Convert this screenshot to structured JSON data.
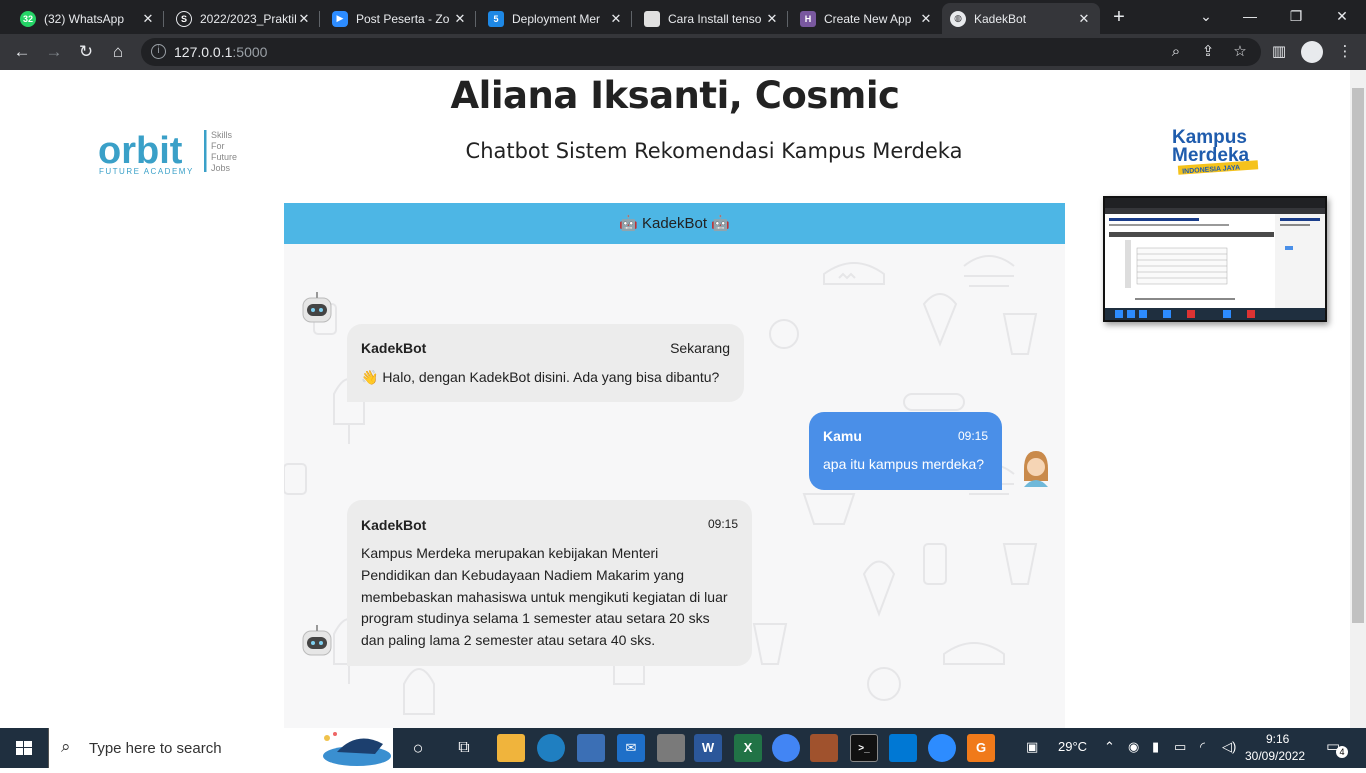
{
  "browser": {
    "tabs": [
      {
        "title": "(32) WhatsApp",
        "icon": "whatsapp-icon",
        "color": "#25d366",
        "badge": "32"
      },
      {
        "title": "2022/2023_Praktik",
        "icon": "s-icon",
        "color": "#5f6368",
        "badge": "S"
      },
      {
        "title": "Post Peserta - Zo",
        "icon": "zoom-icon",
        "color": "#2d8cff",
        "badge": ""
      },
      {
        "title": "Deployment Mer",
        "icon": "five-icon",
        "color": "#1e88e5",
        "badge": "5"
      },
      {
        "title": "Cara Install tenso",
        "icon": "page-icon",
        "color": "#e0e0e0",
        "badge": ""
      },
      {
        "title": "Create New App",
        "icon": "heroku-icon",
        "color": "#79589f",
        "badge": "H"
      },
      {
        "title": "KadekBot",
        "icon": "globe-icon",
        "color": "#9aa0a6",
        "badge": ""
      }
    ],
    "url_host": "127.0.0.1",
    "url_port": ":5000"
  },
  "page": {
    "title": "Aliana Iksanti, Cosmic",
    "subtitle": "Chatbot Sistem Rekomendasi Kampus Merdeka",
    "orbit_logo": {
      "main": "orbit",
      "sub": "FUTURE ACADEMY",
      "tag1": "Skills",
      "tag2": "For",
      "tag3": "Future",
      "tag4": "Jobs"
    },
    "km_logo": {
      "line1": "Kampus",
      "line2": "Merdeka",
      "line3": "INDONESIA JAYA"
    }
  },
  "chat": {
    "header": "🤖 KadekBot 🤖",
    "messages": [
      {
        "sender": "KadekBot",
        "time": "Sekarang",
        "text": "👋 Halo, dengan KadekBot disini. Ada yang bisa dibantu?"
      },
      {
        "sender": "Kamu",
        "time": "09:15",
        "text": "apa itu kampus merdeka?"
      },
      {
        "sender": "KadekBot",
        "time": "09:15",
        "lines": [
          "Kampus Merdeka merupakan kebijakan Menteri",
          "Pendidikan dan Kebudayaan Nadiem Makarim yang",
          "membebaskan mahasiswa untuk mengikuti kegiatan di luar",
          "program studinya selama 1 semester atau setara 20 sks",
          "dan paling lama 2 semester atau setara 40 sks."
        ]
      }
    ]
  },
  "taskbar": {
    "search_placeholder": "Type here to search",
    "weather": "29°C",
    "time": "9:16",
    "date": "30/09/2022",
    "notif_count": "4"
  },
  "colors": {
    "header_blue": "#4db6e5",
    "user_bubble": "#4a8fe8",
    "bot_bubble": "#ececec"
  }
}
